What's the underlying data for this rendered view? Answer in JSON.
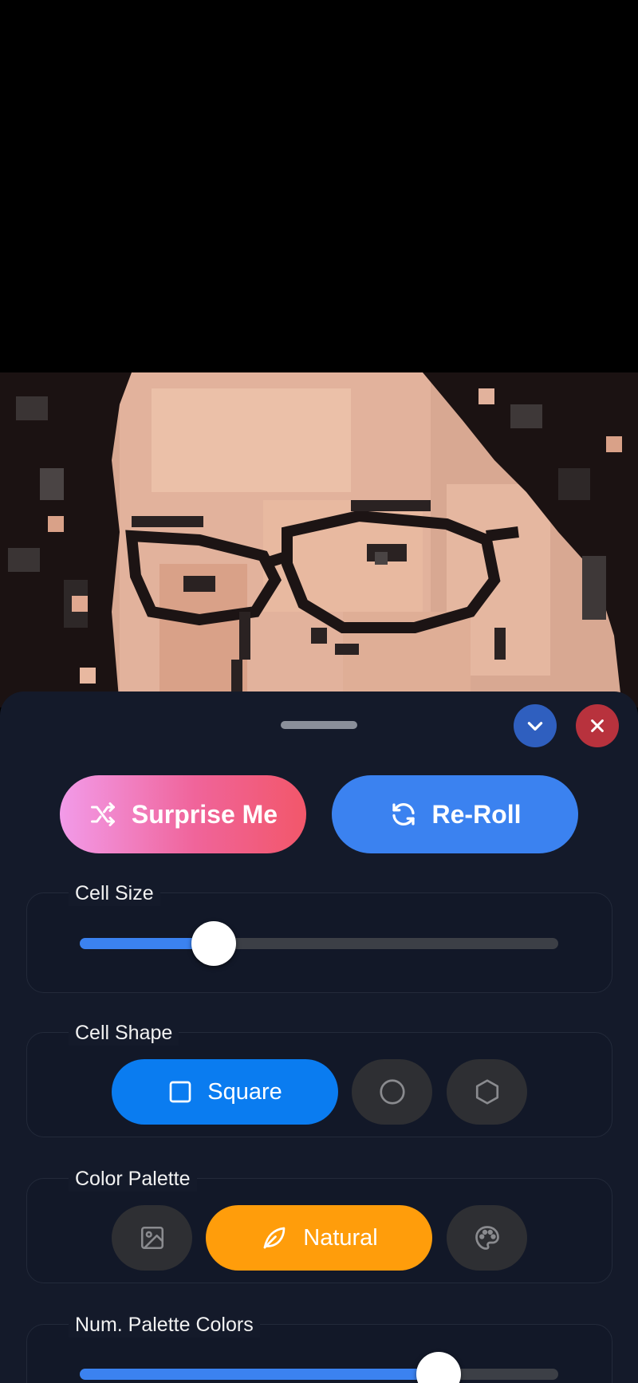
{
  "preview": {
    "image_name": "pixelated-portrait"
  },
  "sheet": {
    "collapse_icon": "chevron-down-icon",
    "close_icon": "close-icon"
  },
  "actions": {
    "surprise_label": "Surprise Me",
    "surprise_icon": "shuffle-icon",
    "reroll_label": "Re-Roll",
    "reroll_icon": "refresh-icon"
  },
  "cell_size": {
    "label": "Cell Size",
    "value_fraction": 0.28
  },
  "cell_shape": {
    "label": "Cell Shape",
    "options": [
      {
        "label": "Square",
        "icon": "square-icon",
        "selected": true
      },
      {
        "label": "",
        "icon": "circle-icon",
        "selected": false
      },
      {
        "label": "",
        "icon": "hexagon-icon",
        "selected": false
      }
    ]
  },
  "color_palette": {
    "label": "Color Palette",
    "options": [
      {
        "label": "",
        "icon": "image-icon",
        "selected": false
      },
      {
        "label": "Natural",
        "icon": "leaf-icon",
        "selected": true
      },
      {
        "label": "",
        "icon": "palette-icon",
        "selected": false
      }
    ]
  },
  "num_palette_colors": {
    "label": "Num. Palette Colors",
    "value_fraction": 0.75
  },
  "colors": {
    "accent_blue": "#3b82f0",
    "selected_blue": "#0a7cf0",
    "selected_orange": "#ff9d0b",
    "close_red": "#b8323d",
    "sheet_bg": "#141a2a"
  }
}
